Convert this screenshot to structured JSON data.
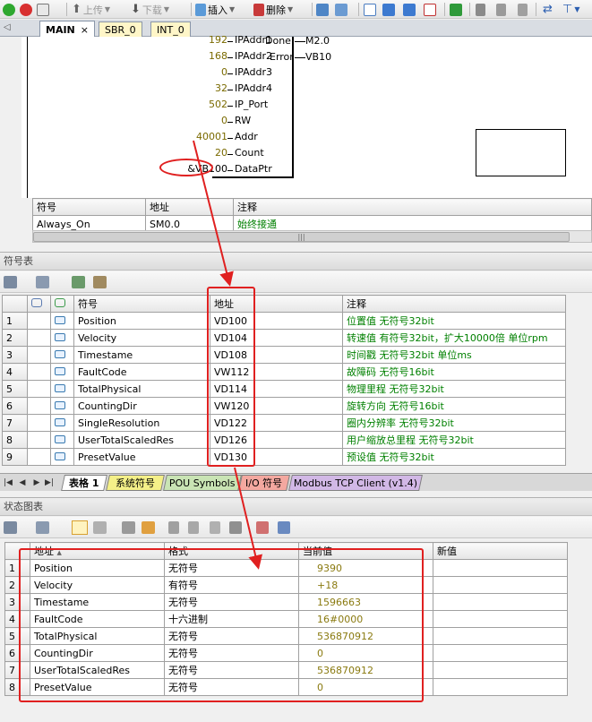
{
  "colors": {
    "accent_red": "#e02020",
    "value_text": "#8a7a10",
    "comment_text": "#008000"
  },
  "toolbar": {
    "upload_label": "上传",
    "download_label": "下载",
    "insert_label": "插入",
    "delete_label": "删除"
  },
  "editor_tabs": [
    {
      "label": "MAIN",
      "close": "×"
    },
    {
      "label": "SBR_0"
    },
    {
      "label": "INT_0"
    }
  ],
  "ladder": {
    "inputs": [
      {
        "value": "192",
        "pin": "IPAddr1"
      },
      {
        "value": "168",
        "pin": "IPAddr2"
      },
      {
        "value": "0",
        "pin": "IPAddr3"
      },
      {
        "value": "32",
        "pin": "IPAddr4"
      },
      {
        "value": "502",
        "pin": "IP_Port"
      },
      {
        "value": "0",
        "pin": "RW"
      },
      {
        "value": "40001",
        "pin": "Addr"
      },
      {
        "value": "20",
        "pin": "Count"
      },
      {
        "value": "&VB100",
        "pin": "DataPtr"
      }
    ],
    "outputs": [
      {
        "pin": "Done",
        "value": "M2.0"
      },
      {
        "pin": "Error",
        "value": "VB10"
      }
    ]
  },
  "network_symbols": {
    "headers": [
      "符号",
      "地址",
      "注释"
    ],
    "rows": [
      [
        "Always_On",
        "SM0.0",
        "始终接通"
      ]
    ],
    "scroll_grip": "|||"
  },
  "symbol_table": {
    "title": "符号表",
    "headers": [
      "符号",
      "地址",
      "注释"
    ],
    "rows": [
      {
        "n": "1",
        "symbol": "Position",
        "address": "VD100",
        "comment": "位置值 无符号32bit"
      },
      {
        "n": "2",
        "symbol": "Velocity",
        "address": "VD104",
        "comment": "转速值 有符号32bit，扩大10000倍 单位rpm"
      },
      {
        "n": "3",
        "symbol": "Timestame",
        "address": "VD108",
        "comment": "时间戳 无符号32bit 单位ms"
      },
      {
        "n": "4",
        "symbol": "FaultCode",
        "address": "VW112",
        "comment": "故障码 无符号16bit"
      },
      {
        "n": "5",
        "symbol": "TotalPhysical",
        "address": "VD114",
        "comment": "物理里程 无符号32bit"
      },
      {
        "n": "6",
        "symbol": "CountingDir",
        "address": "VW120",
        "comment": "旋转方向 无符号16bit"
      },
      {
        "n": "7",
        "symbol": "SingleResolution",
        "address": "VD122",
        "comment": "圈内分辨率 无符号32bit"
      },
      {
        "n": "8",
        "symbol": "UserTotalScaledRes",
        "address": "VD126",
        "comment": "用户缩放总里程 无符号32bit"
      },
      {
        "n": "9",
        "symbol": "PresetValue",
        "address": "VD130",
        "comment": "预设值 无符号32bit"
      }
    ]
  },
  "sheet_tabs": [
    "表格 1",
    "系统符号",
    "POU Symbols",
    "I/O 符号",
    "Modbus TCP Client (v1.4)"
  ],
  "status_chart": {
    "title": "状态图表",
    "headers": [
      "地址",
      "格式",
      "当前值",
      "新值"
    ],
    "sort_indicator": "▲",
    "rows": [
      {
        "n": "1",
        "address": "Position",
        "format": "无符号",
        "current": "9390"
      },
      {
        "n": "2",
        "address": "Velocity",
        "format": "有符号",
        "current": "+18"
      },
      {
        "n": "3",
        "address": "Timestame",
        "format": "无符号",
        "current": "1596663"
      },
      {
        "n": "4",
        "address": "FaultCode",
        "format": "十六进制",
        "current": "16#0000"
      },
      {
        "n": "5",
        "address": "TotalPhysical",
        "format": "无符号",
        "current": "536870912"
      },
      {
        "n": "6",
        "address": "CountingDir",
        "format": "无符号",
        "current": "0"
      },
      {
        "n": "7",
        "address": "UserTotalScaledRes",
        "format": "无符号",
        "current": "536870912"
      },
      {
        "n": "8",
        "address": "PresetValue",
        "format": "无符号",
        "current": "0"
      }
    ]
  }
}
